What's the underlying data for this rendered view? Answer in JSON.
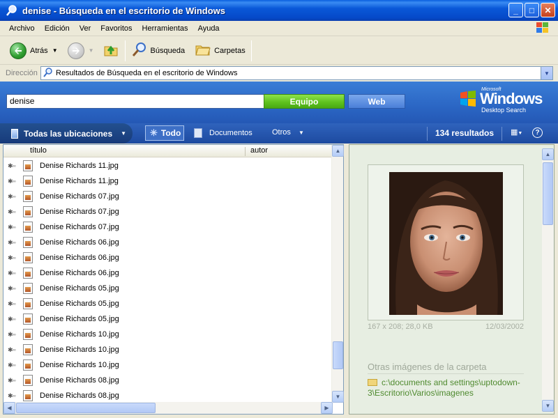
{
  "window": {
    "title": "denise - Búsqueda en el escritorio de Windows",
    "minimize_glyph": "_",
    "maximize_glyph": "□",
    "close_glyph": "✕"
  },
  "menu": [
    "Archivo",
    "Edición",
    "Ver",
    "Favoritos",
    "Herramientas",
    "Ayuda"
  ],
  "toolbar": {
    "back_label": "Atrás",
    "search_label": "Búsqueda",
    "folders_label": "Carpetas"
  },
  "address": {
    "label": "Dirección",
    "value": "Resultados de Búsqueda en el escritorio de Windows"
  },
  "search": {
    "query": "denise",
    "btn_equipo": "Equipo",
    "btn_web": "Web",
    "logo_microsoft": "Microsoft",
    "logo_windows": "Windows",
    "logo_subtitle": "Desktop Search"
  },
  "scope": {
    "all_locations": "Todas las ubicaciones",
    "todo": "Todo",
    "documentos": "Documentos",
    "otros": "Otros",
    "count": "134 resultados",
    "help": "?"
  },
  "columns": {
    "title": "título",
    "author": "autor"
  },
  "results": [
    "Denise Richards 11.jpg",
    "Denise Richards 11.jpg",
    "Denise Richards 07.jpg",
    "Denise Richards 07.jpg",
    "Denise Richards 07.jpg",
    "Denise Richards 06.jpg",
    "Denise Richards 06.jpg",
    "Denise Richards 06.jpg",
    "Denise Richards 05.jpg",
    "Denise Richards 05.jpg",
    "Denise Richards 05.jpg",
    "Denise Richards 10.jpg",
    "Denise Richards 10.jpg",
    "Denise Richards 10.jpg",
    "Denise Richards 08.jpg",
    "Denise Richards 08.jpg"
  ],
  "rank_glyph": "✱◦◦",
  "preview": {
    "dimensions": "167 x 208;",
    "size": "28,0 KB",
    "date": "12/03/2002",
    "other_title": "Otras imágenes de la carpeta",
    "folder_path": "c:\\documents and settings\\uptodown-3\\Escritorio\\Varios\\imagenes"
  },
  "colors": {
    "titlebar": "#0a58d8",
    "equipo": "#5cbf1c",
    "web": "#4a7fd8",
    "link": "#4f8a2f"
  }
}
